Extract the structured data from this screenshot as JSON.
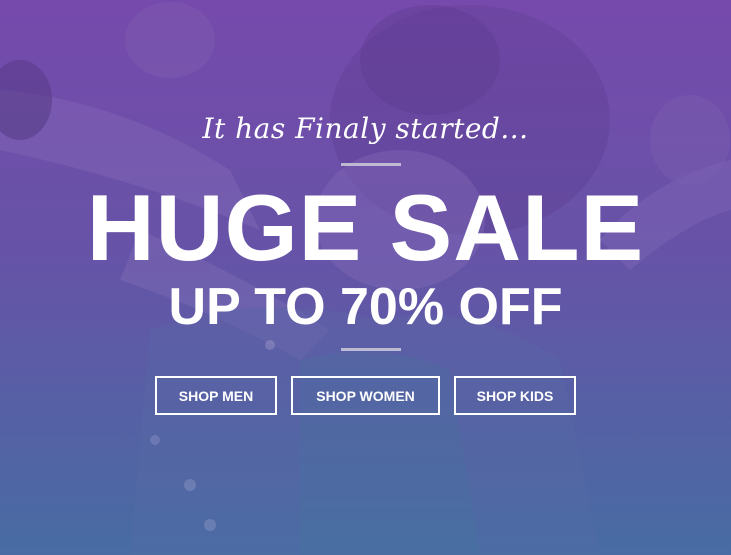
{
  "banner": {
    "tagline": "It has Finaly started...",
    "headline": "HUGE SALE",
    "subheadline": "UP TO 70% OFF",
    "buttons": {
      "men": "SHOP MEN",
      "women": "SHOP WOMEN",
      "kids": "SHOP KIDS"
    }
  },
  "colors": {
    "overlay_top": "#7a4fae",
    "overlay_bottom": "#4f6fa6",
    "text": "#ffffff",
    "divider": "#cdcddc"
  }
}
